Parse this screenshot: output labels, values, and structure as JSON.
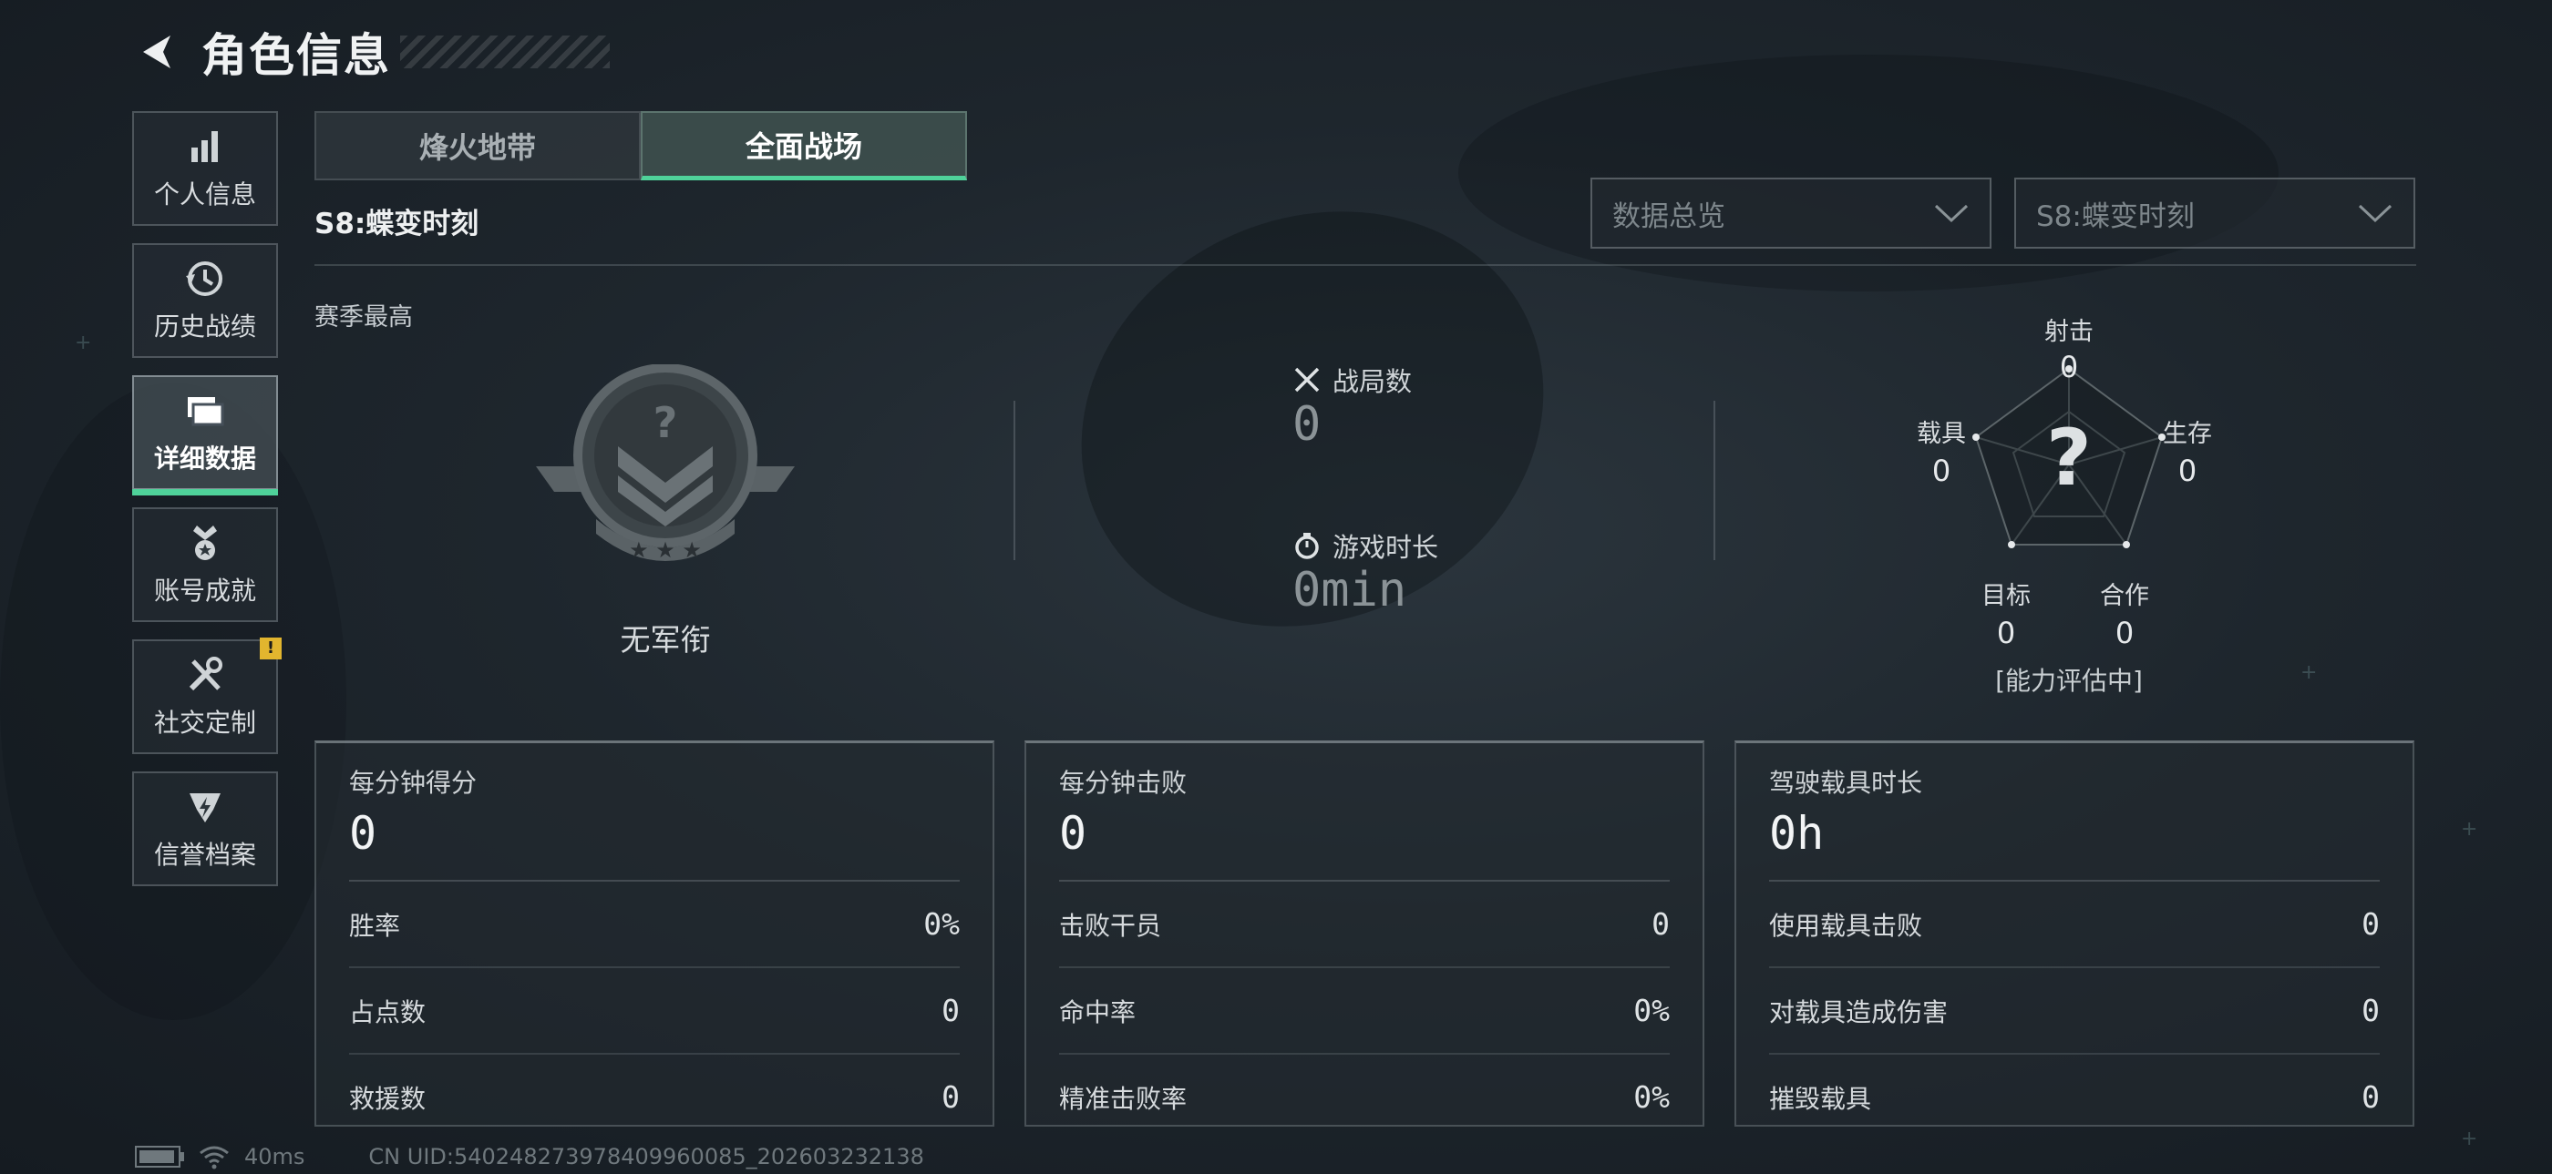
{
  "header": {
    "title": "角色信息"
  },
  "sidebar": {
    "items": [
      {
        "label": "个人信息",
        "icon": "bar-chart-icon"
      },
      {
        "label": "历史战绩",
        "icon": "history-icon"
      },
      {
        "label": "详细数据",
        "icon": "folders-icon",
        "active": true
      },
      {
        "label": "账号成就",
        "icon": "medal-icon"
      },
      {
        "label": "社交定制",
        "icon": "tools-icon",
        "badge": "!"
      },
      {
        "label": "信誉档案",
        "icon": "shield-lightning-icon"
      }
    ]
  },
  "tabs": [
    {
      "label": "烽火地带",
      "active": false
    },
    {
      "label": "全面战场",
      "active": true
    }
  ],
  "season": {
    "title": "S8:蝶变时刻"
  },
  "dropdowns": {
    "data_type": "数据总览",
    "season": "S8:蝶变时刻"
  },
  "overview": {
    "section_label": "赛季最高",
    "rank": "无军衔",
    "matches_label": "战局数",
    "matches_value": "0",
    "playtime_label": "游戏时长",
    "playtime_value": "0min"
  },
  "radar": {
    "shooting_label": "射击",
    "shooting_value": "0",
    "survival_label": "生存",
    "survival_value": "0",
    "teamwork_label": "合作",
    "teamwork_value": "0",
    "objective_label": "目标",
    "objective_value": "0",
    "vehicle_label": "载具",
    "vehicle_value": "0",
    "center_mark": "?",
    "note": "[能力评估中]"
  },
  "cards": [
    {
      "title": "每分钟得分",
      "big": "0",
      "rows": [
        {
          "label": "胜率",
          "value": "0%"
        },
        {
          "label": "占点数",
          "value": "0"
        },
        {
          "label": "救援数",
          "value": "0"
        }
      ]
    },
    {
      "title": "每分钟击败",
      "big": "0",
      "rows": [
        {
          "label": "击败干员",
          "value": "0"
        },
        {
          "label": "命中率",
          "value": "0%"
        },
        {
          "label": "精准击败率",
          "value": "0%"
        }
      ]
    },
    {
      "title": "驾驶载具时长",
      "big": "0h",
      "rows": [
        {
          "label": "使用载具击败",
          "value": "0"
        },
        {
          "label": "对载具造成伤害",
          "value": "0"
        },
        {
          "label": "摧毁载具",
          "value": "0"
        }
      ]
    }
  ],
  "footer": {
    "ping": "40ms",
    "uid": "CN UID:540248273978409960085_202603232138"
  },
  "colors": {
    "accent": "#4fd29a",
    "badge": "#e2b52e"
  }
}
